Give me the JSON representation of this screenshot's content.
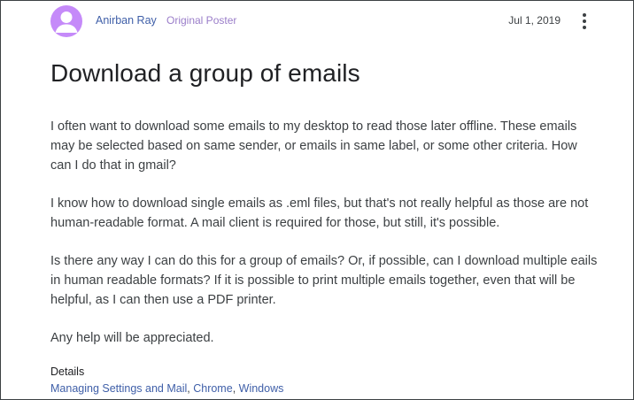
{
  "post": {
    "author": "Anirban Ray",
    "badge": "Original Poster",
    "date": "Jul 1, 2019",
    "title": "Download a group of emails",
    "paragraphs": [
      "I often want to download some emails to my desktop to read those later offline. These emails may be selected based on same sender, or emails in same label, or some other criteria. How can I do that in gmail?",
      "I know how to download single emails as .eml files, but that's not really helpful as those are not human-readable format. A mail client is required for those, but still, it's possible.",
      "Is there any way I can do this for a group of emails? Or, if possible, can I download multiple eails in human readable formats? If it is possible to print multiple emails together, even that will be helpful, as I can then use a PDF printer.",
      "Any help will be appreciated."
    ]
  },
  "details": {
    "label": "Details",
    "links": [
      "Managing Settings and Mail",
      "Chrome",
      "Windows"
    ],
    "separator": ", "
  },
  "icons": {
    "avatar": "person-icon",
    "menu": "more-vert-icon"
  },
  "colors": {
    "avatar_bg": "#c58af9",
    "link": "#3f5fa8",
    "badge": "#9a7dc9"
  }
}
